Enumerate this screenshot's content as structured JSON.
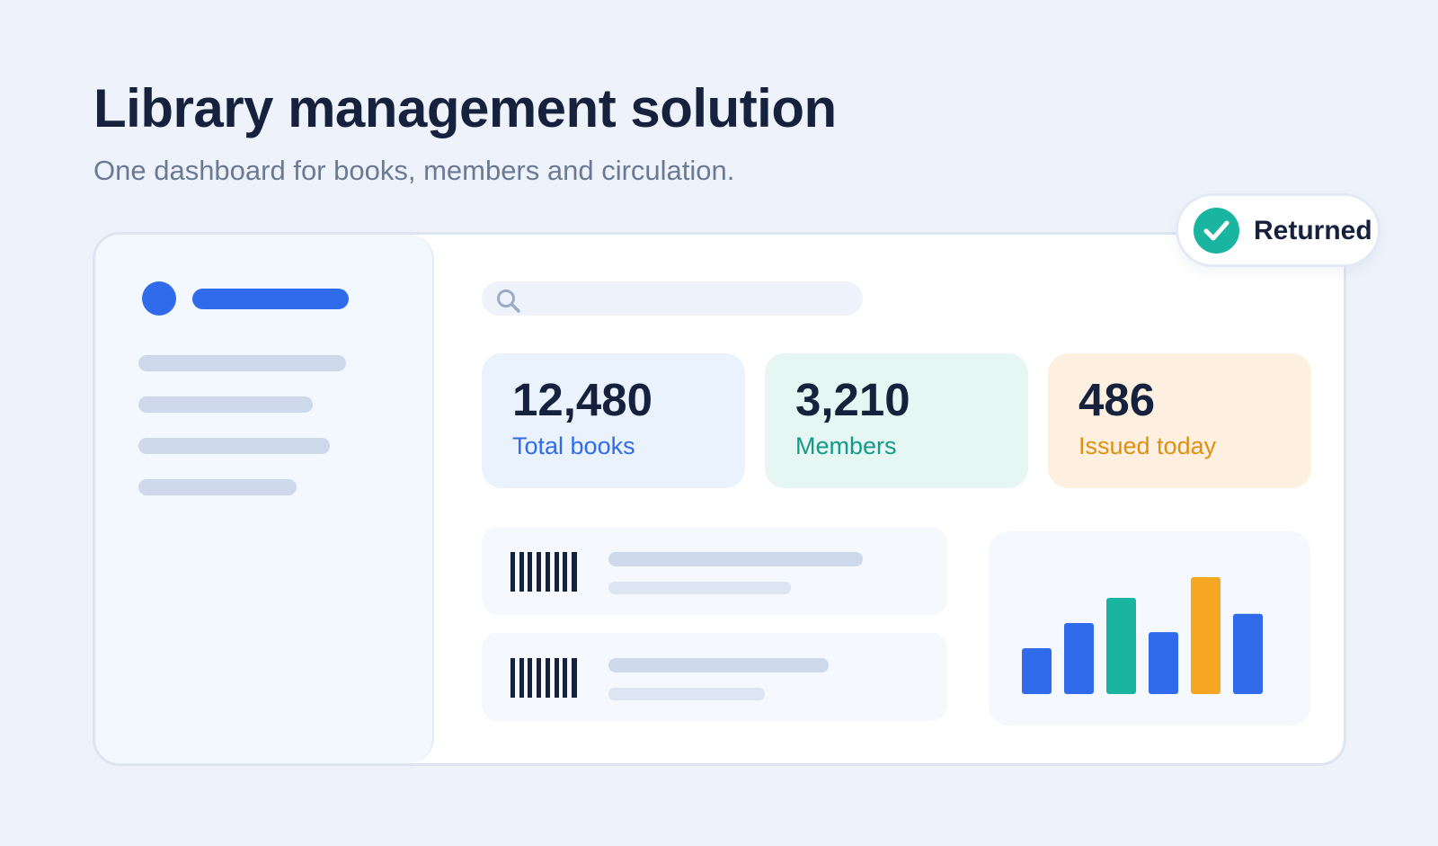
{
  "header": {
    "title": "Library management solution",
    "subtitle": "One dashboard for books, members and circulation."
  },
  "stats": [
    {
      "value": "12,480",
      "label": "Total books",
      "accent": "#2f6bea",
      "background": "#eaf2fe"
    },
    {
      "value": "3,210",
      "label": "Members",
      "accent": "#139a88",
      "background": "#e5f6f3"
    },
    {
      "value": "486",
      "label": "Issued today",
      "accent": "#e08f12",
      "background": "#fdf0e0"
    }
  ],
  "badge": {
    "label": "Returned",
    "icon": "checkmark-icon",
    "color": "#1ab5a0"
  },
  "search": {
    "icon": "search-icon"
  },
  "colors": {
    "background": "#eef3fb",
    "primary": "#2f6bea",
    "teal": "#1ab5a0",
    "orange": "#f5a623",
    "text": "#15213d",
    "placeholder_bar": "#cdd8ea"
  },
  "chart_data": {
    "type": "bar",
    "values": [
      2,
      3.1,
      4.2,
      2.7,
      5.1,
      3.5
    ],
    "colors": [
      "#2f6bea",
      "#2f6bea",
      "#1ab5a0",
      "#2f6bea",
      "#f5a623",
      "#2f6bea"
    ],
    "title": "",
    "xlabel": "",
    "ylabel": "",
    "grid": false,
    "legend": "none"
  }
}
